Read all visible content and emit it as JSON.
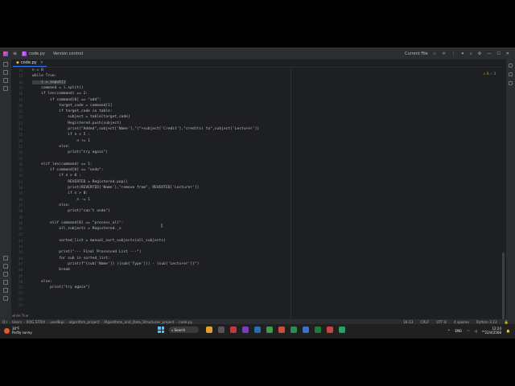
{
  "titlebar": {
    "menu_icon": "hamburger-icon",
    "project_badge": "C",
    "file_name": "code.py",
    "version_control": "Version control",
    "run_config": "Current File"
  },
  "tab": {
    "label": "code.py"
  },
  "inspection": {
    "warnings": "⚠ 6",
    "ok": "✓ 3"
  },
  "code_lines": [
    {
      "n": "14",
      "t": "n = 0"
    },
    {
      "n": "15",
      "t": "while True:"
    },
    {
      "n": "16",
      "t": "    i = input()"
    },
    {
      "n": "17",
      "t": "    command = i.split()"
    },
    {
      "n": "18",
      "t": "    if len(command) == 2:"
    },
    {
      "n": "19",
      "t": "        if command[0] == \"add\":"
    },
    {
      "n": "20",
      "t": "            target_code = command[1]"
    },
    {
      "n": "21",
      "t": "            if target_code in table:"
    },
    {
      "n": "22",
      "t": "                subject = table[target_code]"
    },
    {
      "n": "23",
      "t": "                Registered.push(subject)"
    },
    {
      "n": "24",
      "t": "                print(\"Added\",subject['Name'],\"(\"+subject['Credit'],\"credits) to\",subject['Lecturer'])"
    },
    {
      "n": "25",
      "t": "                if n < 5 :"
    },
    {
      "n": "26",
      "t": "                    n += 1"
    },
    {
      "n": "27",
      "t": "            else:"
    },
    {
      "n": "28",
      "t": "                print(\"try again\")"
    },
    {
      "n": "29",
      "t": ""
    },
    {
      "n": "30",
      "t": "    elif len(command) == 1:"
    },
    {
      "n": "31",
      "t": "        if command[0] == \"undo\":"
    },
    {
      "n": "32",
      "t": "            if n > 0 :"
    },
    {
      "n": "33",
      "t": "                REVERTED = Registered.pop()"
    },
    {
      "n": "34",
      "t": "                print(REVERTED['Name'],\"remove from\", REVERTED['Lecturer'])"
    },
    {
      "n": "35",
      "t": "                if n > 0:"
    },
    {
      "n": "36",
      "t": "                    n -= 1"
    },
    {
      "n": "37",
      "t": "            else:"
    },
    {
      "n": "38",
      "t": "                print(\"can't undo\")"
    },
    {
      "n": "39",
      "t": ""
    },
    {
      "n": "40",
      "t": "        elif command[0] == \"process_all\":"
    },
    {
      "n": "41",
      "t": "            all_subjects = Registered._s"
    },
    {
      "n": "42",
      "t": ""
    },
    {
      "n": "43",
      "t": "            sorted_list = manual_sort_subjects(all_subjects)"
    },
    {
      "n": "44",
      "t": ""
    },
    {
      "n": "45",
      "t": "            print(\"--- Final Processed List ---\")"
    },
    {
      "n": "46",
      "t": "            for sub in sorted_list:"
    },
    {
      "n": "47",
      "t": "                print(f\"{sub['Name']} ({sub['Type']}) - {sub['Lecturer']}\")"
    },
    {
      "n": "48",
      "t": "            break"
    },
    {
      "n": "49",
      "t": ""
    },
    {
      "n": "50",
      "t": "    else:"
    },
    {
      "n": "51",
      "t": "        print(\"try again\")"
    },
    {
      "n": "52",
      "t": ""
    },
    {
      "n": "53",
      "t": ""
    },
    {
      "n": "54",
      "t": ""
    }
  ],
  "terminal_hint": "while True",
  "breadcrumb": [
    "D:\\",
    "Users",
    "ROG STRIX",
    "userBup",
    "algorithm_project",
    "Algorithms_and_Data_Structures_project",
    "code.py"
  ],
  "status": {
    "position": "16:13",
    "line_sep": "CRLF",
    "encoding": "UTF-8",
    "indent": "4 spaces",
    "interpreter": "Python 3.13"
  },
  "taskbar": {
    "weather_temp": "30°F",
    "weather_desc": "Partly sunny",
    "search": "Search",
    "lang": "ENG",
    "time": "12:24",
    "date": "22/4/2568"
  },
  "colors": {
    "accent": "#3574f0",
    "editor_bg": "#1e1f22",
    "chrome_bg": "#2b2d30"
  }
}
